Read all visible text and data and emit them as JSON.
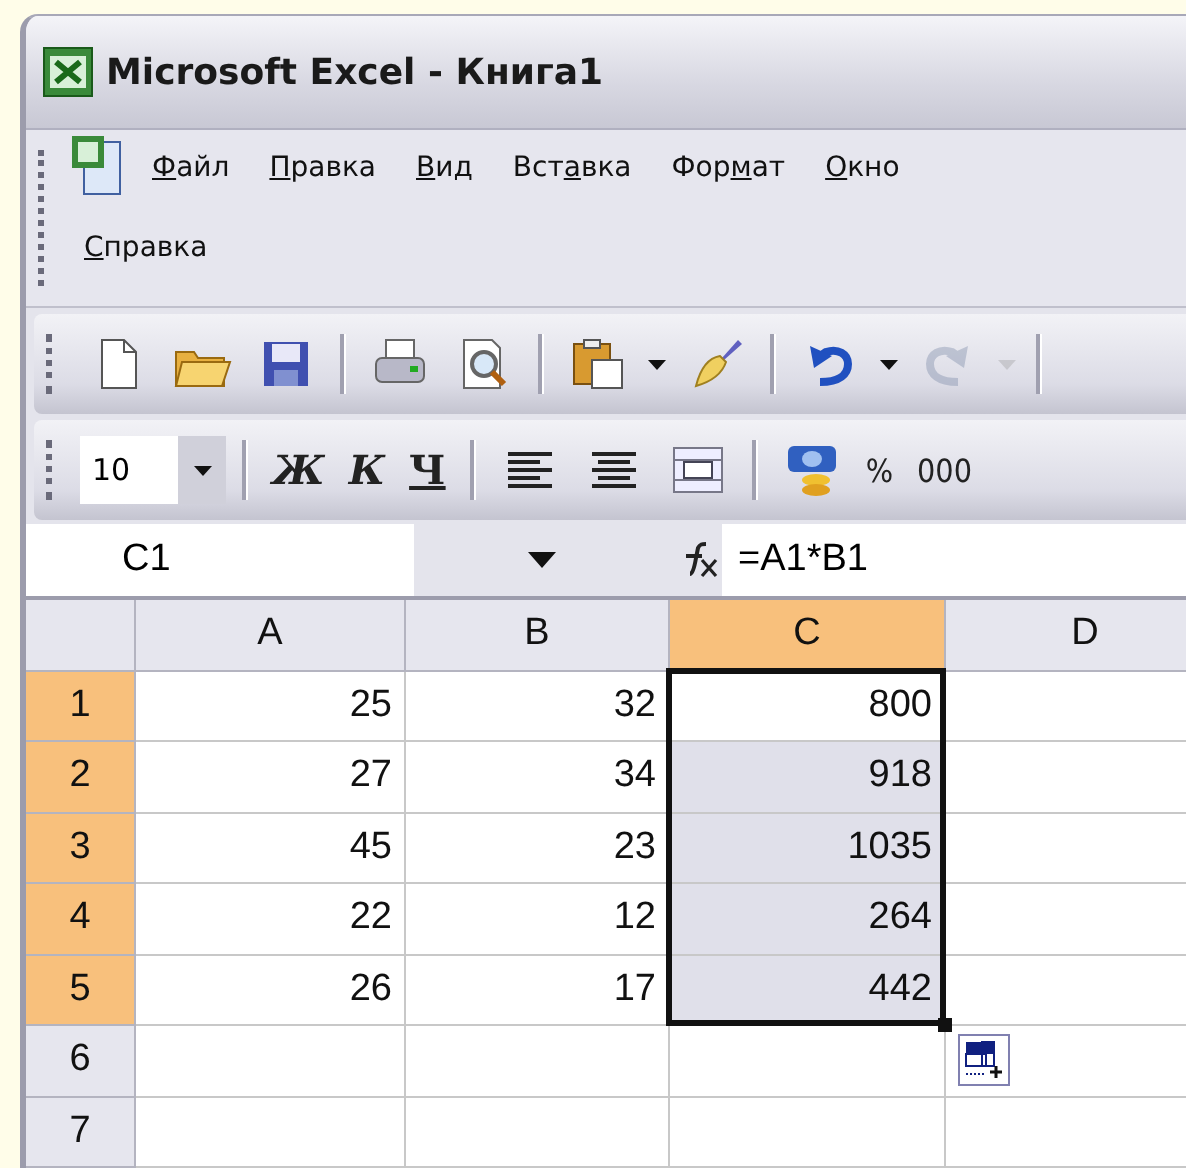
{
  "window": {
    "title": "Microsoft Excel - Книга1"
  },
  "menu": [
    {
      "key": "Ф",
      "after": "айл"
    },
    {
      "key": "П",
      "after": "равка"
    },
    {
      "key": "В",
      "after": "ид"
    },
    {
      "before": "Вст",
      "key": "а",
      "after": "вка"
    },
    {
      "before": "Фор",
      "key": "м",
      "after": "ат"
    },
    {
      "key": "О",
      "after": "кно"
    },
    {
      "key": "С",
      "after": "правка"
    }
  ],
  "standard_toolbar": [
    {
      "kind": "new",
      "disabled": false
    },
    {
      "kind": "open",
      "disabled": false
    },
    {
      "kind": "save",
      "disabled": false
    },
    {
      "kind": "separator"
    },
    {
      "kind": "print",
      "disabled": false
    },
    {
      "kind": "preview",
      "disabled": false
    },
    {
      "kind": "separator"
    },
    {
      "kind": "paste",
      "disabled": false
    },
    {
      "kind": "dropdown",
      "disabled": false
    },
    {
      "kind": "brush",
      "disabled": false
    },
    {
      "kind": "separator"
    },
    {
      "kind": "undo",
      "disabled": false
    },
    {
      "kind": "dropdown",
      "disabled": false
    },
    {
      "kind": "redo",
      "disabled": true
    },
    {
      "kind": "dropdown",
      "disabled": true
    },
    {
      "kind": "separator"
    }
  ],
  "format_toolbar": [
    {
      "kind": "font_size",
      "value": "10"
    },
    {
      "kind": "separator"
    },
    {
      "kind": "bold",
      "label": "Ж"
    },
    {
      "kind": "italic",
      "label": "К"
    },
    {
      "kind": "underline",
      "label": "Ч"
    },
    {
      "kind": "separator"
    },
    {
      "kind": "align_left"
    },
    {
      "kind": "align_center"
    },
    {
      "kind": "merge"
    },
    {
      "kind": "separator"
    },
    {
      "kind": "currency"
    },
    {
      "kind": "text",
      "label": "%"
    },
    {
      "kind": "text",
      "label": "000"
    }
  ],
  "formula_bar": {
    "name_box": "C1",
    "formula": "=A1*B1"
  },
  "sheet": {
    "columns": [
      {
        "label": "A",
        "selected": false
      },
      {
        "label": "B",
        "selected": false
      },
      {
        "label": "C",
        "selected": true
      },
      {
        "label": "D",
        "selected": false
      }
    ],
    "rows": [
      {
        "header": "1",
        "selected": true,
        "cells": [
          {
            "value": "25",
            "selected": false
          },
          {
            "value": "32",
            "selected": false
          },
          {
            "value": "800",
            "selected": true,
            "active": true
          },
          {
            "selected": false
          }
        ]
      },
      {
        "header": "2",
        "selected": true,
        "cells": [
          {
            "value": "27",
            "selected": false
          },
          {
            "value": "34",
            "selected": false
          },
          {
            "value": "918",
            "selected": true
          },
          {
            "selected": false
          }
        ]
      },
      {
        "header": "3",
        "selected": true,
        "cells": [
          {
            "value": "45",
            "selected": false
          },
          {
            "value": "23",
            "selected": false
          },
          {
            "value": "1035",
            "selected": true
          },
          {
            "selected": false
          }
        ]
      },
      {
        "header": "4",
        "selected": true,
        "cells": [
          {
            "value": "22",
            "selected": false
          },
          {
            "value": "12",
            "selected": false
          },
          {
            "value": "264",
            "selected": true
          },
          {
            "selected": false
          }
        ]
      },
      {
        "header": "5",
        "selected": true,
        "cells": [
          {
            "value": "26",
            "selected": false
          },
          {
            "value": "17",
            "selected": false
          },
          {
            "value": "442",
            "selected": true
          },
          {
            "selected": false
          }
        ]
      },
      {
        "header": "6",
        "selected": false,
        "cells": [
          {
            "selected": false
          },
          {
            "selected": false
          },
          {
            "selected": false
          },
          {
            "selected": false
          }
        ]
      },
      {
        "header": "7",
        "selected": false,
        "cells": [
          {
            "selected": false
          },
          {
            "selected": false
          },
          {
            "selected": false
          },
          {
            "selected": false
          }
        ]
      }
    ]
  }
}
